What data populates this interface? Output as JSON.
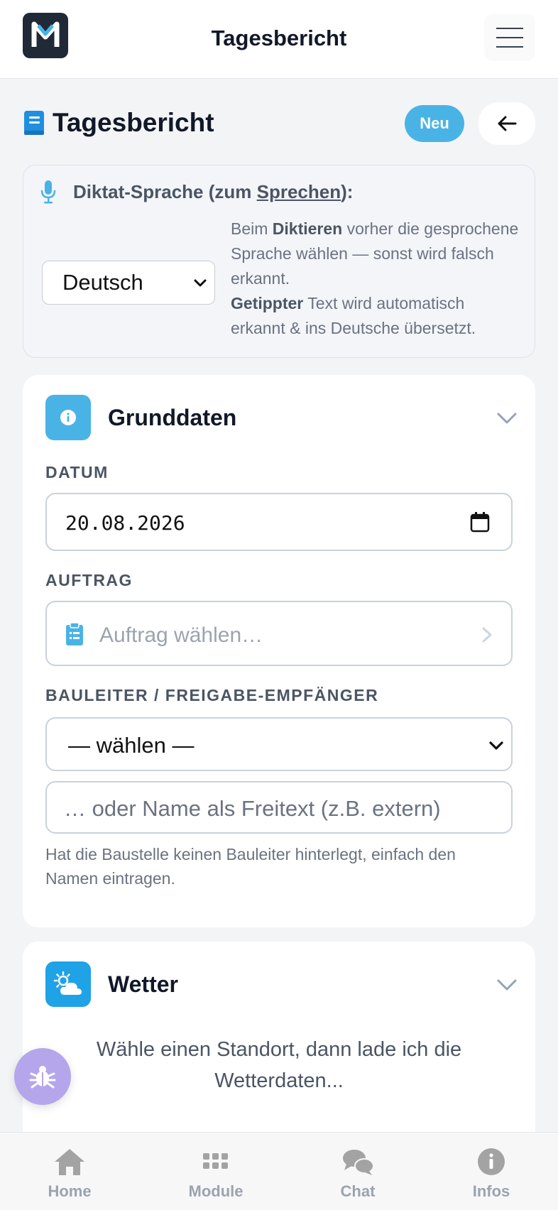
{
  "header": {
    "title": "Tagesbericht"
  },
  "page": {
    "title": "Tagesbericht",
    "new_label": "Neu"
  },
  "dictation": {
    "label_pre": "Diktat-Sprache (zum ",
    "label_link": "Sprechen",
    "label_post": "):",
    "language": "Deutsch",
    "info_1_pre": "Beim ",
    "info_1_bold": "Diktieren",
    "info_1_post": " vorher die gesprochene Sprache wählen — sonst wird falsch erkannt.",
    "info_2_bold": "Getippter",
    "info_2_post": " Text wird automatisch erkannt & ins Deutsche übersetzt."
  },
  "grunddaten": {
    "title": "Grunddaten",
    "datum_label": "DATUM",
    "datum_value": "20.08.2026",
    "auftrag_label": "AUFTRAG",
    "auftrag_placeholder": "Auftrag wählen…",
    "bauleiter_label": "BAULEITER / FREIGABE-EMPFÄNGER",
    "bauleiter_value": "— wählen —",
    "freitext_placeholder": "… oder Name als Freitext (z.B. extern)",
    "hint": "Hat die Baustelle keinen Bauleiter hinterlegt, einfach den Namen eintragen."
  },
  "wetter": {
    "title": "Wetter",
    "message": "Wähle einen Standort, dann lade ich die Wetterdaten..."
  },
  "nav": {
    "home": "Home",
    "module": "Module",
    "chat": "Chat",
    "infos": "Infos"
  },
  "colors": {
    "accent": "#4ab3e5",
    "info_icon_bg": "#4ab3e5",
    "weather_icon_bg": "#1fa2e6",
    "fab": "#b5a6ec"
  }
}
